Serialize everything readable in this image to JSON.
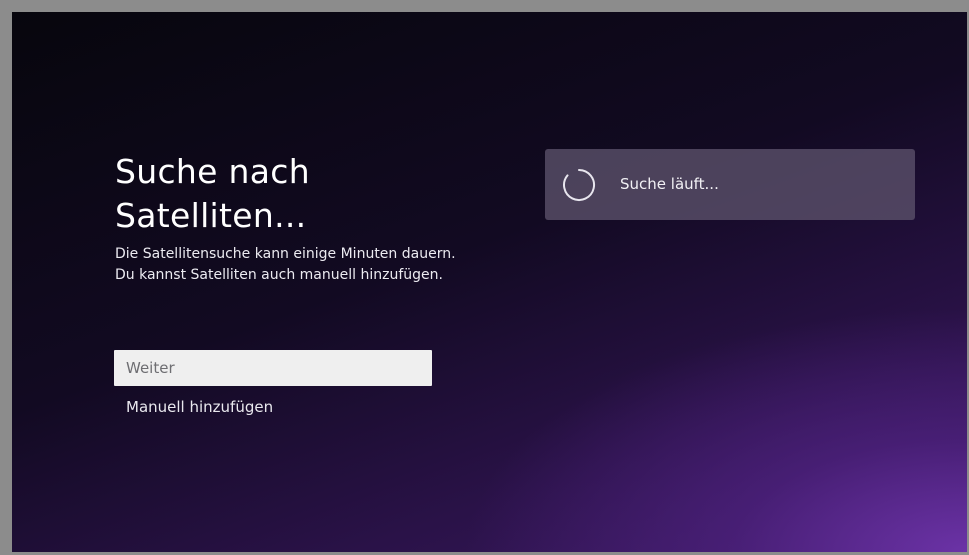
{
  "search": {
    "title": "Suche nach Satelliten...",
    "description": "Die Satellitensuche kann einige Minuten dauern. Du kannst Satelliten auch manuell hinzufügen."
  },
  "actions": {
    "continue_label": "Weiter",
    "manual_label": "Manuell hinzufügen"
  },
  "status": {
    "text": "Suche läuft...",
    "icon": "loading-spinner-icon"
  },
  "colors": {
    "background_dark": "#07060d",
    "background_accent": "#6e34aa",
    "panel": "#5c526c",
    "focused_button": "#efefef",
    "text": "#ffffff"
  }
}
